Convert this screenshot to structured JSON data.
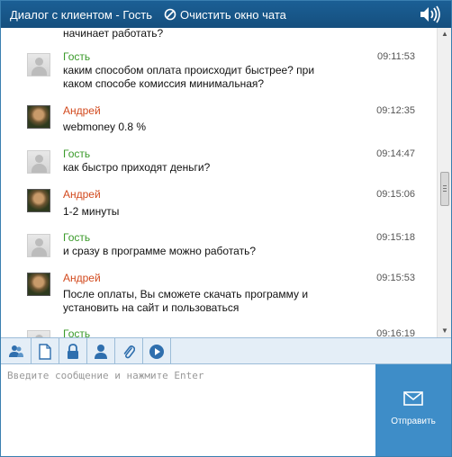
{
  "header": {
    "title": "Диалог с клиентом - Гость",
    "clear_label": "Очистить окно чата",
    "sound_icon": "speaker-icon"
  },
  "colors": {
    "header_bg": "#17578a",
    "guest_name": "#3a9a2a",
    "agent_name": "#d24a1e",
    "send_bg": "#3e8dc8"
  },
  "chat": {
    "partial_top_text": "начинает работать?",
    "messages": [
      {
        "author": "Гость",
        "role": "guest",
        "time": "09:11:53",
        "lines": [
          "каким способом оплата происходит быстрее? при",
          "каком способе комиссия минимальная?"
        ]
      },
      {
        "author": "Андрей",
        "role": "agent",
        "time": "09:12:35",
        "lines": [
          "webmoney 0.8 %"
        ]
      },
      {
        "author": "Гость",
        "role": "guest",
        "time": "09:14:47",
        "lines": [
          "как быстро приходят деньги?"
        ]
      },
      {
        "author": "Андрей",
        "role": "agent",
        "time": "09:15:06",
        "lines": [
          "1-2 минуты"
        ]
      },
      {
        "author": "Гость",
        "role": "guest",
        "time": "09:15:18",
        "lines": [
          "и сразу в программе можно работать?"
        ]
      },
      {
        "author": "Андрей",
        "role": "agent",
        "time": "09:15:53",
        "lines": [
          "После оплаты, Вы сможете скачать программу и",
          "установить на сайт и пользоваться"
        ]
      },
      {
        "author": "Гость",
        "role": "guest",
        "time": "09:16:19",
        "lines": []
      }
    ]
  },
  "toolbar": {
    "buttons": [
      "users-icon",
      "document-icon",
      "lock-icon",
      "person-icon",
      "paperclip-icon",
      "play-icon"
    ]
  },
  "composer": {
    "placeholder": "Введите сообщение и нажмите Enter",
    "value": "",
    "send_label": "Отправить",
    "send_icon": "envelope-icon"
  }
}
